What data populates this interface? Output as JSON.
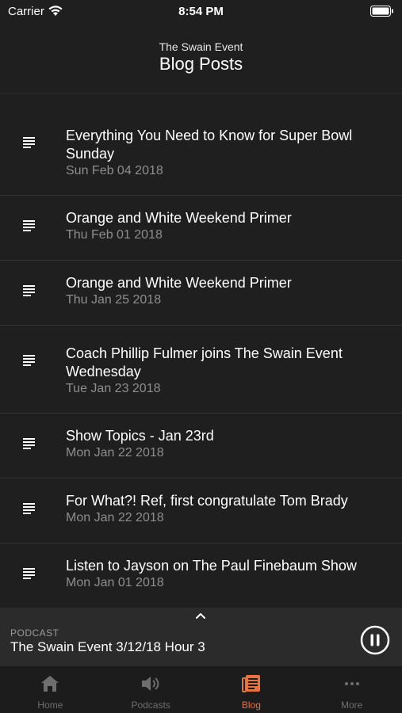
{
  "status": {
    "carrier": "Carrier",
    "time": "8:54 PM"
  },
  "header": {
    "subtitle": "The Swain Event",
    "title": "Blog Posts"
  },
  "posts": [
    {
      "title": "Everything You Need to Know for Super Bowl Sunday",
      "date": "Sun Feb 04 2018"
    },
    {
      "title": "Orange and White Weekend Primer",
      "date": "Thu Feb 01 2018"
    },
    {
      "title": "Orange and White Weekend Primer",
      "date": "Thu Jan 25 2018"
    },
    {
      "title": "Coach Phillip Fulmer joins The Swain Event Wednesday",
      "date": "Tue Jan 23 2018"
    },
    {
      "title": "Show Topics - Jan 23rd",
      "date": "Mon Jan 22 2018"
    },
    {
      "title": "For What?! Ref, first congratulate Tom Brady",
      "date": "Mon Jan 22 2018"
    },
    {
      "title": "Listen to Jayson on The Paul Finebaum Show",
      "date": "Mon Jan 01 2018"
    }
  ],
  "player": {
    "label": "PODCAST",
    "title": "The Swain Event 3/12/18 Hour 3",
    "state": "playing"
  },
  "tabs": [
    {
      "label": "Home",
      "icon": "home-icon",
      "active": false
    },
    {
      "label": "Podcasts",
      "icon": "speaker-icon",
      "active": false
    },
    {
      "label": "Blog",
      "icon": "blog-icon",
      "active": true
    },
    {
      "label": "More",
      "icon": "more-icon",
      "active": false
    }
  ],
  "colors": {
    "background": "#1f1f1f",
    "accent": "#e8723a",
    "secondary_text": "#8e8e8e",
    "player_background": "#2b2b2b"
  }
}
